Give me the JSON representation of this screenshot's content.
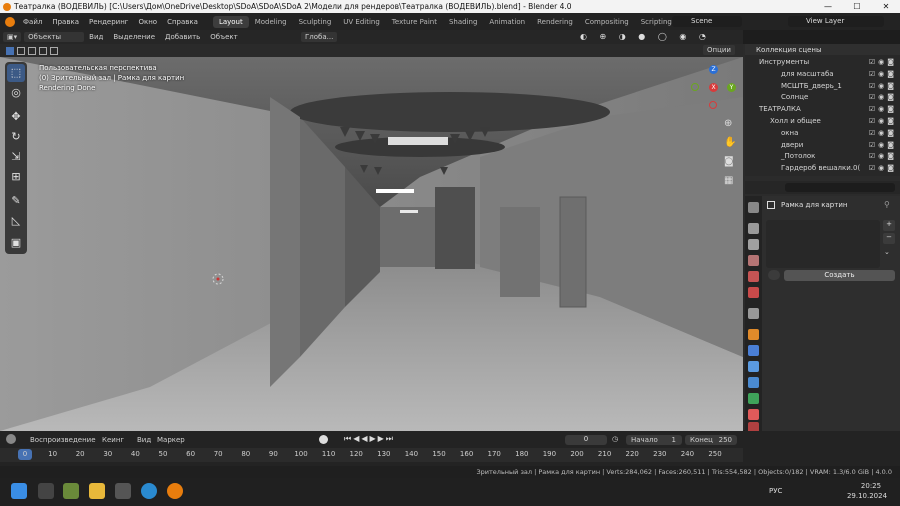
{
  "window": {
    "title": "Театралка (ВОДЕВИЛЬ) [C:\\Users\\Дом\\OneDrive\\Desktop\\SDoA\\SDoA\\SDoA 2\\Модели для рендеров\\Театралка (ВОДЕВИЛЬ).blend] - Blender 4.0",
    "minimize": "—",
    "maximize": "☐",
    "close": "✕"
  },
  "menu": [
    "Файл",
    "Правка",
    "Рендеринг",
    "Окно",
    "Справка"
  ],
  "workspaces": [
    "Layout",
    "Modeling",
    "Sculpting",
    "UV Editing",
    "Texture Paint",
    "Shading",
    "Animation",
    "Rendering",
    "Compositing",
    "Scripting",
    "+"
  ],
  "scene": {
    "label": "Scene",
    "view_layer": "View Layer"
  },
  "viewport_header": {
    "mode": "Объекты",
    "items": [
      "Вид",
      "Выделение",
      "Добавить",
      "Объект"
    ],
    "transform": "Глоба...",
    "options": "Опции"
  },
  "overlay": {
    "line1": "Пользовательская перспектива",
    "line2": "(0) Зрительный зал | Рамка для картин",
    "line3": "Rendering Done"
  },
  "gizmo": {
    "z": "Z",
    "y": "Y",
    "x": "X"
  },
  "outliner": {
    "header": "Коллекция сцены",
    "rows": [
      {
        "label": "Инструменты",
        "indent": 0,
        "sel": false
      },
      {
        "label": "для масштаба",
        "indent": 2,
        "sel": false
      },
      {
        "label": "МСШТБ_дверь_1",
        "indent": 2,
        "sel": false
      },
      {
        "label": "Солнце",
        "indent": 2,
        "sel": false
      },
      {
        "label": "ТЕАТРАЛКА",
        "indent": 0,
        "sel": false
      },
      {
        "label": "Холл и общее",
        "indent": 1,
        "sel": false
      },
      {
        "label": "окна",
        "indent": 2,
        "sel": false
      },
      {
        "label": "двери",
        "indent": 2,
        "sel": false
      },
      {
        "label": "_Потолок",
        "indent": 2,
        "sel": false
      },
      {
        "label": "Гардероб вешалки.0(",
        "indent": 2,
        "sel": false
      }
    ]
  },
  "properties": {
    "object_name": "Рамка для картин",
    "create_button": "Создать"
  },
  "timeline": {
    "menu": [
      "Воспроизведение",
      "Кеинг",
      "Вид",
      "Маркер"
    ],
    "current_frame": "0",
    "start_label": "Начало",
    "start_value": "1",
    "end_label": "Конец",
    "end_value": "250",
    "ticks": [
      "0",
      "10",
      "20",
      "30",
      "40",
      "50",
      "60",
      "70",
      "80",
      "90",
      "100",
      "110",
      "120",
      "130",
      "140",
      "150",
      "160",
      "170",
      "180",
      "190",
      "200",
      "210",
      "220",
      "230",
      "240",
      "250"
    ]
  },
  "status": {
    "text": "Зрительный зал | Рамка для картин | Verts:284,062 | Faces:260,511 | Tris:554,582 | Objects:0/182 | VRAM: 1.3/6.0 GiB | 4.0.0"
  },
  "taskbar": {
    "lang": "РУС",
    "time": "20:25",
    "date": "29.10.2024"
  }
}
